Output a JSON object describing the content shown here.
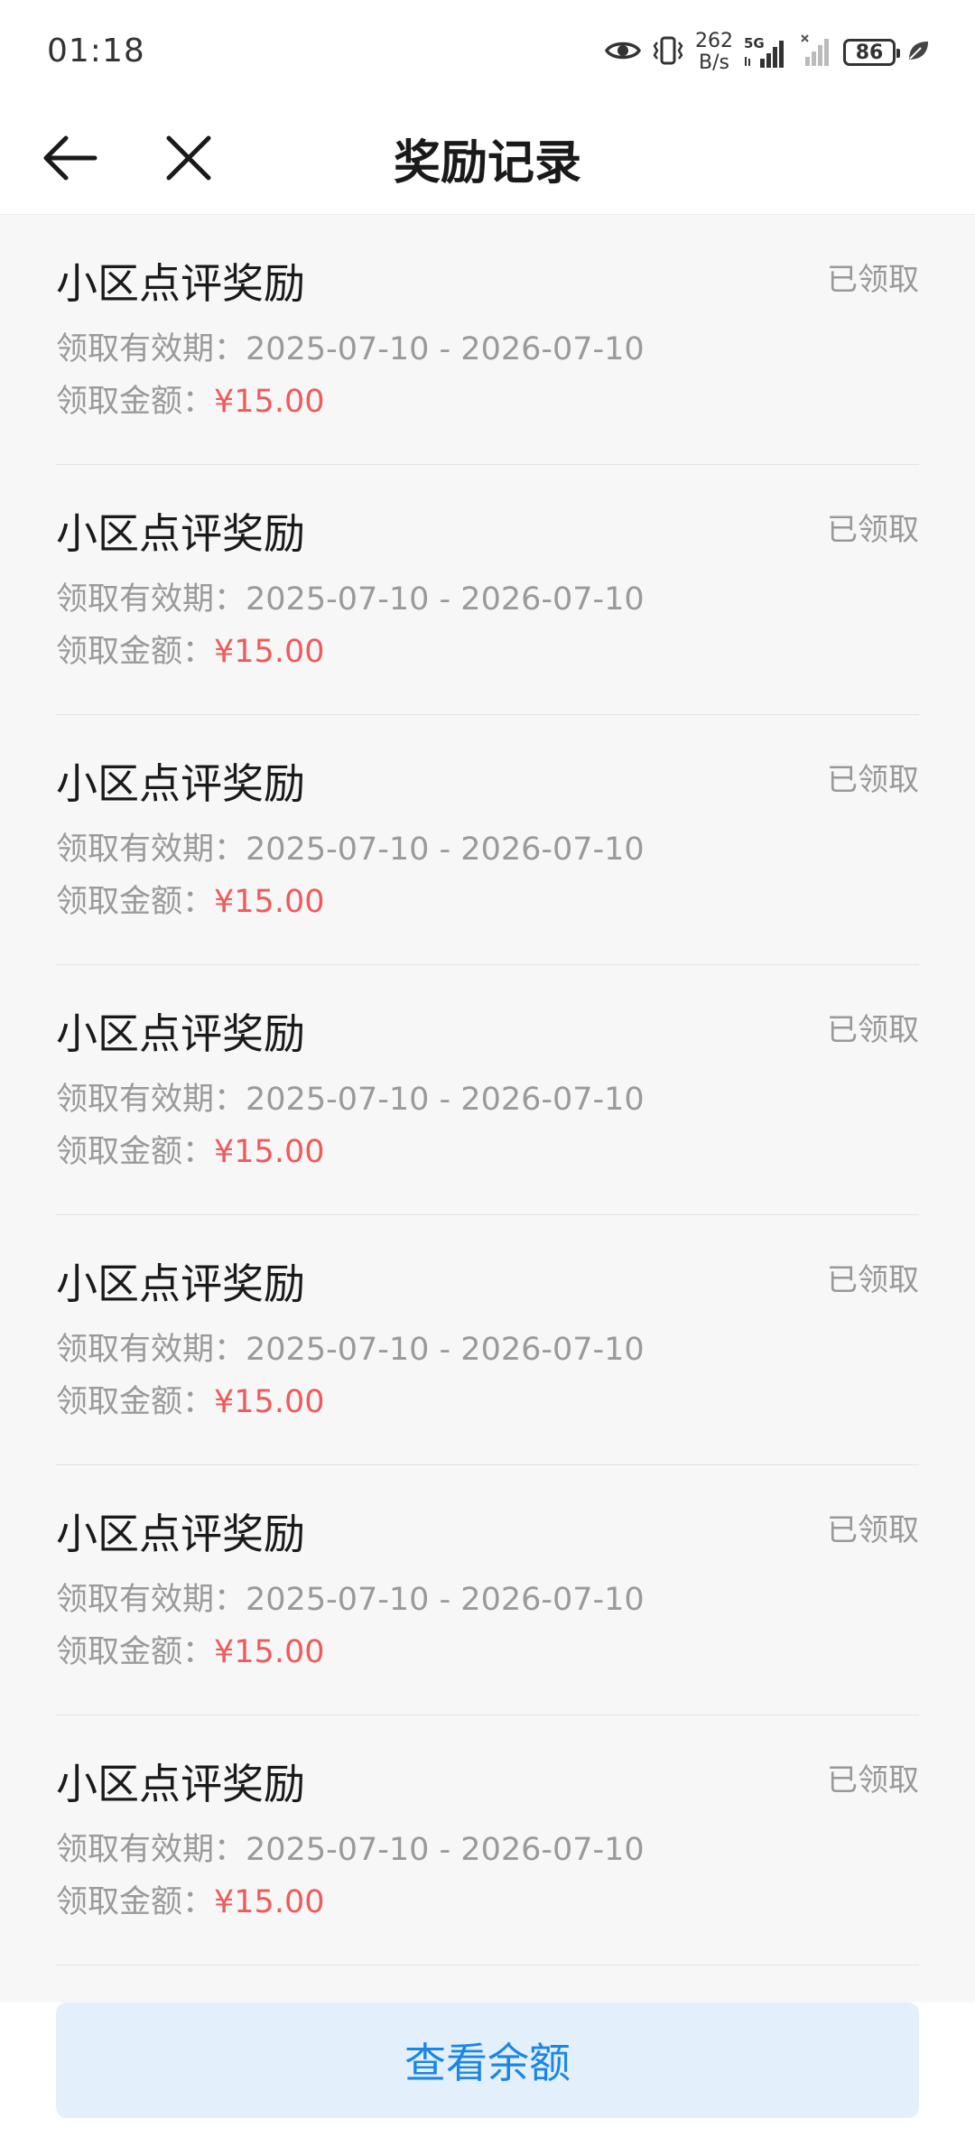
{
  "status_bar": {
    "time": "01:18",
    "net_speed_value": "262",
    "net_speed_unit": "B/s",
    "network_type": "5G",
    "battery_level": "86"
  },
  "header": {
    "title": "奖励记录"
  },
  "records": [
    {
      "title": "小区点评奖励",
      "status": "已领取",
      "validity_label": "领取有效期：",
      "validity_range": "2025-07-10 - 2026-07-10",
      "amount_label": "领取金额：",
      "amount": "¥15.00"
    },
    {
      "title": "小区点评奖励",
      "status": "已领取",
      "validity_label": "领取有效期：",
      "validity_range": "2025-07-10 - 2026-07-10",
      "amount_label": "领取金额：",
      "amount": "¥15.00"
    },
    {
      "title": "小区点评奖励",
      "status": "已领取",
      "validity_label": "领取有效期：",
      "validity_range": "2025-07-10 - 2026-07-10",
      "amount_label": "领取金额：",
      "amount": "¥15.00"
    },
    {
      "title": "小区点评奖励",
      "status": "已领取",
      "validity_label": "领取有效期：",
      "validity_range": "2025-07-10 - 2026-07-10",
      "amount_label": "领取金额：",
      "amount": "¥15.00"
    },
    {
      "title": "小区点评奖励",
      "status": "已领取",
      "validity_label": "领取有效期：",
      "validity_range": "2025-07-10 - 2026-07-10",
      "amount_label": "领取金额：",
      "amount": "¥15.00"
    },
    {
      "title": "小区点评奖励",
      "status": "已领取",
      "validity_label": "领取有效期：",
      "validity_range": "2025-07-10 - 2026-07-10",
      "amount_label": "领取金额：",
      "amount": "¥15.00"
    },
    {
      "title": "小区点评奖励",
      "status": "已领取",
      "validity_label": "领取有效期：",
      "validity_range": "2025-07-10 - 2026-07-10",
      "amount_label": "领取金额：",
      "amount": "¥15.00"
    }
  ],
  "footer": {
    "balance_button_label": "查看余额"
  },
  "icons": {
    "back": "arrow-left-icon",
    "close": "close-icon",
    "eye": "eye-icon",
    "vibrate": "vibrate-icon",
    "signal": "signal-icon",
    "leaf": "leaf-icon"
  },
  "colors": {
    "amount": "#f05a5a",
    "button_bg": "#e3effb",
    "button_text": "#1a87e6",
    "muted_text": "#9a9a9a"
  }
}
